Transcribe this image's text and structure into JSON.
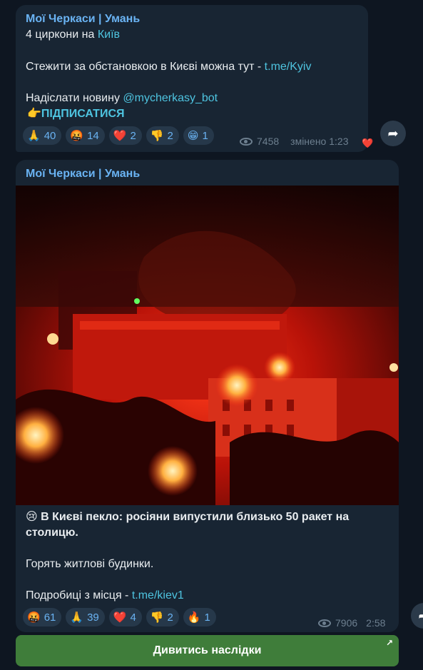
{
  "messages": [
    {
      "channel": "Мої Черкаси | Умань",
      "line1_text": "4 циркони на ",
      "line1_link": "Київ",
      "line2_text": "Стежити за обстановкою в Києві можна тут - ",
      "line2_link": "t.me/Kyiv",
      "line3_text": "Надіслати новину ",
      "line3_link": "@mycherkasy_bot",
      "subscribe_emoji": "👉",
      "subscribe_label": "ПІДПИСАТИСЯ",
      "reactions": [
        {
          "emoji": "🙏",
          "count": "40"
        },
        {
          "emoji": "🤬",
          "count": "14"
        },
        {
          "emoji": "❤️",
          "count": "2"
        },
        {
          "emoji": "👎",
          "count": "2"
        },
        {
          "emoji": "😁",
          "count": "1"
        }
      ],
      "views": "7458",
      "edited": "змінено 1:23",
      "own_reaction": "❤️"
    },
    {
      "channel": "Мої Черкаси | Умань",
      "headline_emoji": "😢",
      "headline": "В Києві пекло: росіяни випустили близько 50 ракет на столицю.",
      "body1": "Горять житлові будинки.",
      "body2_text": "Подробиці з місця - ",
      "body2_link": "t.me/kiev1",
      "reactions": [
        {
          "emoji": "🤬",
          "count": "61"
        },
        {
          "emoji": "🙏",
          "count": "39"
        },
        {
          "emoji": "❤️",
          "count": "4"
        },
        {
          "emoji": "👎",
          "count": "2"
        },
        {
          "emoji": "🔥",
          "count": "1"
        }
      ],
      "views": "7906",
      "time": "2:58",
      "button_label": "Дивитись наслідки",
      "button_corner_icon": "↗"
    }
  ],
  "share_icon": "➦",
  "colors": {
    "background": "#0e1621",
    "bubble": "#182533",
    "channel": "#6ab3f3",
    "link": "#4ec4e0",
    "button": "#3f7d3a"
  }
}
